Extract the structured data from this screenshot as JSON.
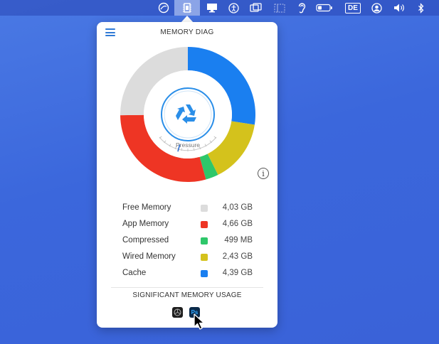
{
  "menubar": {
    "keyboard_layout": "DE",
    "icons": [
      "weather-icon",
      "memory-chip-icon",
      "display-icon",
      "accessibility-icon",
      "window-icon",
      "sidebar-icon",
      "hearing-icon",
      "battery-icon",
      "keyboard-layout-icon",
      "user-icon",
      "volume-icon",
      "bluetooth-icon"
    ]
  },
  "popover": {
    "title": "MEMORY DIAG",
    "gauge_label": "Pressure",
    "pressure_level": 0.35,
    "legend": [
      {
        "label": "Free Memory",
        "value": "4,03 GB",
        "color": "#dcdcdc"
      },
      {
        "label": "App Memory",
        "value": "4,66 GB",
        "color": "#ee3524"
      },
      {
        "label": "Compressed",
        "value": "499 MB",
        "color": "#2ec76a"
      },
      {
        "label": "Wired Memory",
        "value": "2,43 GB",
        "color": "#d4c21c"
      },
      {
        "label": "Cache",
        "value": "4,39 GB",
        "color": "#1a7ff0"
      }
    ],
    "significant_title": "SIGNIFICANT MEMORY USAGE",
    "apps": [
      {
        "name": "aperture-app-icon",
        "glyph": "",
        "bg": "#1e1e1e",
        "fg": "#cccccc"
      },
      {
        "name": "photoshop-app-icon",
        "glyph": "Ps",
        "bg": "#0b2a4a",
        "fg": "#31a8ff"
      }
    ],
    "info_glyph": "i"
  }
}
